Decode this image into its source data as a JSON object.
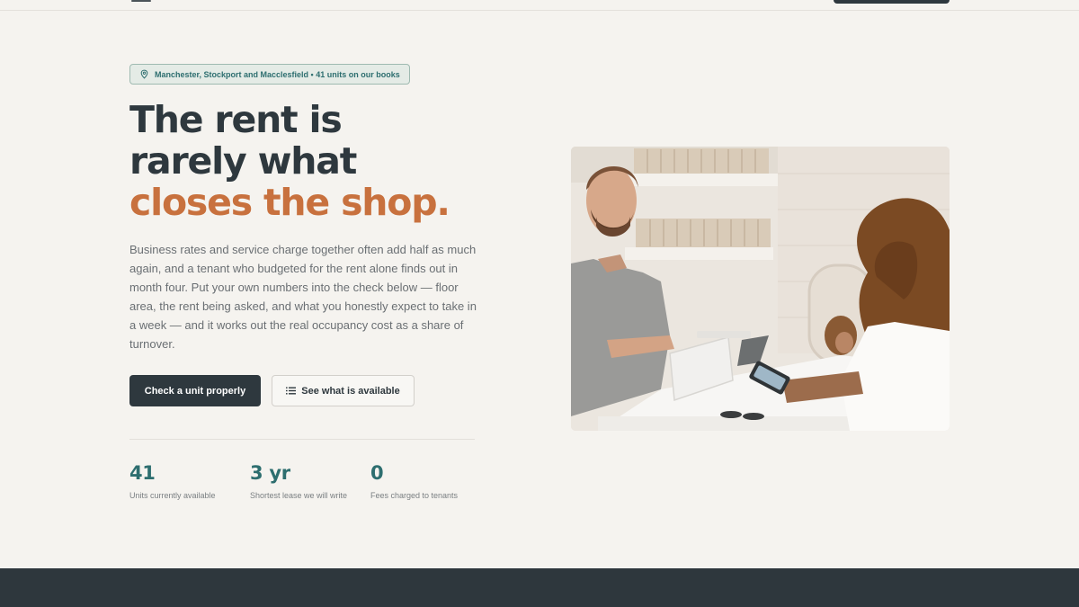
{
  "hero": {
    "location_pill": "Manchester, Stockport and Macclesfield • 41 units on our books",
    "headline_line1": "The rent is",
    "headline_line2": "rarely what",
    "headline_accent": "closes the shop.",
    "lead": "Business rates and service charge together often add half as much again, and a tenant who budgeted for the rent alone finds out in month four. Put your own numbers into the check below — floor area, the rent being asked, and what you honestly expect to take in a week — and it works out the real occupancy cost as a share of turnover.",
    "primary_cta": "Check a unit properly",
    "secondary_cta": "See what is available"
  },
  "stats": [
    {
      "value": "41",
      "label": "Units currently available"
    },
    {
      "value": "3 yr",
      "label": "Shortest lease we will write"
    },
    {
      "value": "0",
      "label": "Fees charged to tenants"
    }
  ],
  "icons": {
    "pin": "map-pin-icon",
    "list": "list-icon"
  },
  "colors": {
    "background": "#f5f3ef",
    "ink": "#2e383e",
    "accent_orange": "#c8713e",
    "accent_teal": "#2d6e6f",
    "pill_bg": "#e4ebe6",
    "footer": "#2e373d"
  }
}
